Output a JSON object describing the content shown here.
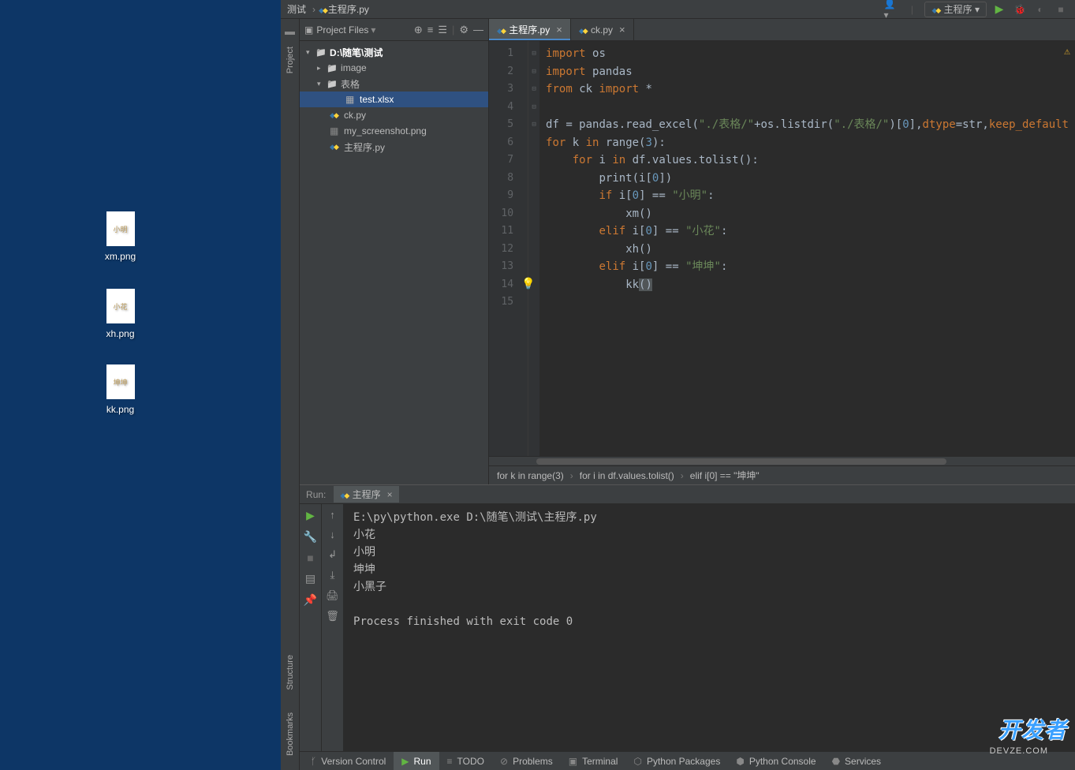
{
  "desktop": {
    "icons": [
      {
        "thumb_text": "小明",
        "label": "xm.png"
      },
      {
        "thumb_text": "小花",
        "label": "xh.png"
      },
      {
        "thumb_text": "坤坤",
        "label": "kk.png"
      }
    ]
  },
  "navbar": {
    "crumb1": "测试",
    "crumb2": "主程序.py",
    "run_config": "主程序"
  },
  "project": {
    "header_label": "Project Files",
    "root": "D:\\随笔\\测试",
    "folder_image": "image",
    "folder_tables": "表格",
    "file_test": "test.xlsx",
    "file_ck": "ck.py",
    "file_screenshot": "my_screenshot.png",
    "file_main": "主程序.py"
  },
  "tabs": {
    "tab1": "主程序.py",
    "tab2": "ck.py"
  },
  "gutter_lines": [
    "1",
    "2",
    "3",
    "4",
    "5",
    "6",
    "7",
    "8",
    "9",
    "10",
    "11",
    "12",
    "13",
    "14",
    "15"
  ],
  "code": {
    "l1_kw": "import",
    "l1_mod": "os",
    "l2_kw": "import",
    "l2_mod": "pandas",
    "l3_kw1": "from",
    "l3_mod": "ck",
    "l3_kw2": "import",
    "l3_star": "*",
    "l5_a": "df = pandas.read_excel(",
    "l5_s1": "\"./表格/\"",
    "l5_b": "+os.listdir(",
    "l5_s2": "\"./表格/\"",
    "l5_c": ")[",
    "l5_n0": "0",
    "l5_d": "],",
    "l5_p1": "dtype",
    "l5_e": "=str,",
    "l5_p2": "keep_default",
    "l6_kw1": "for",
    "l6_var": " k ",
    "l6_kw2": "in",
    "l6_fn": " range(",
    "l6_num": "3",
    "l6_end": "):",
    "l7_pad": "    ",
    "l7_kw1": "for",
    "l7_var": " i ",
    "l7_kw2": "in",
    "l7_rest": " df.values.tolist():",
    "l8_pad": "        ",
    "l8_fn": "print",
    "l8_a": "(i[",
    "l8_n": "0",
    "l8_b": "])",
    "l9_pad": "        ",
    "l9_kw": "if",
    "l9_a": " i[",
    "l9_n": "0",
    "l9_b": "] == ",
    "l9_s": "\"小明\"",
    "l9_c": ":",
    "l10_pad": "            ",
    "l10_fn": "xm()",
    "l11_pad": "        ",
    "l11_kw": "elif",
    "l11_a": " i[",
    "l11_n": "0",
    "l11_b": "] == ",
    "l11_s": "\"小花\"",
    "l11_c": ":",
    "l12_pad": "            ",
    "l12_fn": "xh()",
    "l13_pad": "        ",
    "l13_kw": "elif",
    "l13_a": " i[",
    "l13_n": "0",
    "l13_b": "] == ",
    "l13_s": "\"坤坤\"",
    "l13_c": ":",
    "l14_pad": "            ",
    "l14_fn": "kk",
    "l14_p": "()"
  },
  "breadcrumbs": {
    "b1": "for k in range(3)",
    "b2": "for i in df.values.tolist()",
    "b3": "elif i[0] == \"坤坤\""
  },
  "run": {
    "label": "Run:",
    "tab_name": "主程序",
    "line1": "E:\\py\\python.exe D:\\随笔\\测试\\主程序.py",
    "line2": "小花",
    "line3": "小明",
    "line4": "坤坤",
    "line5": "小黑子",
    "line6": "",
    "line7": "Process finished with exit code 0"
  },
  "sidebar": {
    "project": "Project",
    "structure": "Structure",
    "bookmarks": "Bookmarks"
  },
  "bottom": {
    "vc": "Version Control",
    "run": "Run",
    "todo": "TODO",
    "problems": "Problems",
    "terminal": "Terminal",
    "packages": "Python Packages",
    "console": "Python Console",
    "services": "Services"
  },
  "watermark": {
    "main": "开发者",
    "sub": "DEVZE.COM"
  }
}
